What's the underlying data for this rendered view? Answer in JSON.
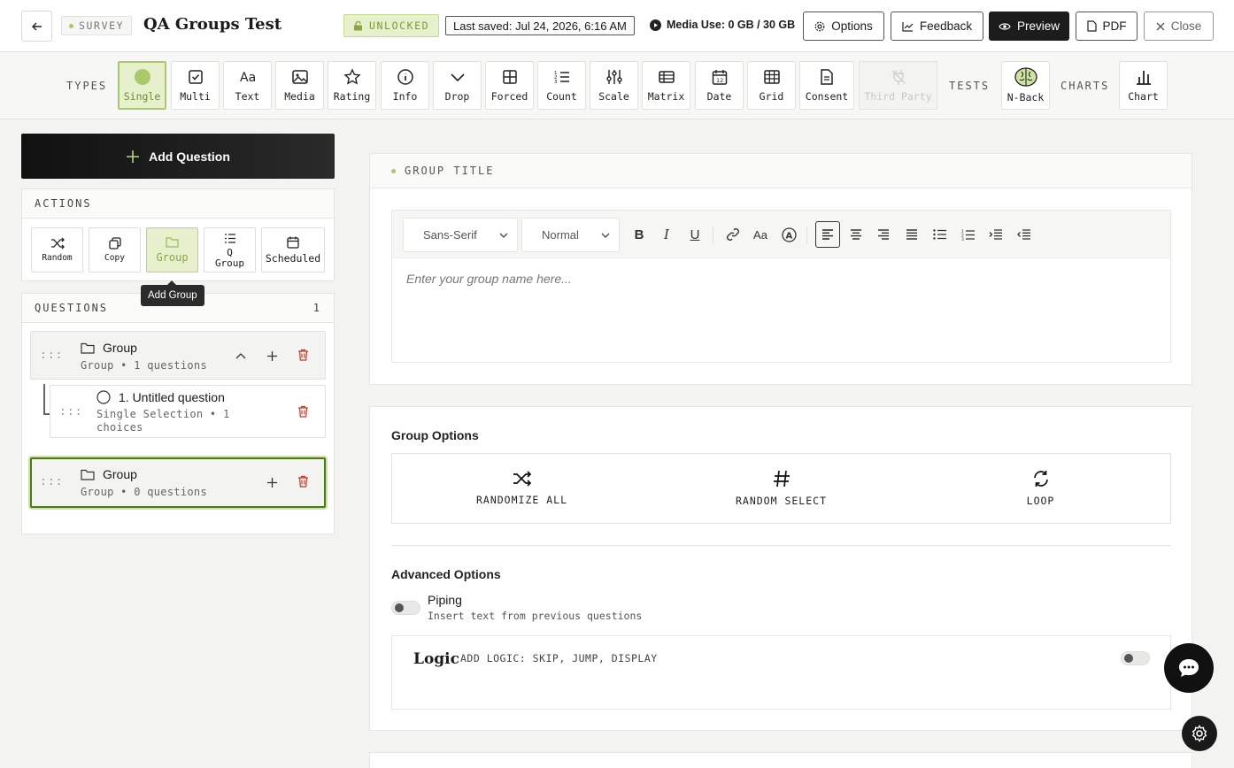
{
  "header": {
    "survey_tag": "SURVEY",
    "title": "QA Groups Test",
    "lock_status": "UNLOCKED",
    "last_saved": "Last saved: Jul 24, 2026, 6:16 AM",
    "media_use": "Media Use: 0 GB / 30 GB",
    "buttons": {
      "options": "Options",
      "feedback": "Feedback",
      "preview": "Preview",
      "pdf": "PDF",
      "close": "Close"
    }
  },
  "toolbar": {
    "types_label": "TYPES",
    "tests_label": "TESTS",
    "charts_label": "CHARTS",
    "types": [
      {
        "label": "Single",
        "icon": "circle-icon",
        "active": true
      },
      {
        "label": "Multi",
        "icon": "checkbox-icon"
      },
      {
        "label": "Text",
        "icon": "text-aa-icon"
      },
      {
        "label": "Media",
        "icon": "image-icon"
      },
      {
        "label": "Rating",
        "icon": "star-icon"
      },
      {
        "label": "Info",
        "icon": "info-icon"
      },
      {
        "label": "Drop",
        "icon": "chevron-down-icon"
      },
      {
        "label": "Forced",
        "icon": "grid-icon"
      },
      {
        "label": "Count",
        "icon": "numbered-list-icon"
      },
      {
        "label": "Scale",
        "icon": "sliders-icon"
      },
      {
        "label": "Matrix",
        "icon": "table-icon"
      },
      {
        "label": "Date",
        "icon": "calendar-icon"
      },
      {
        "label": "Grid",
        "icon": "grid-table-icon"
      },
      {
        "label": "Consent",
        "icon": "document-icon"
      },
      {
        "label": "Third Party",
        "icon": "plug-icon",
        "disabled": true
      }
    ],
    "tests": [
      {
        "label": "N-Back",
        "icon": "brain-icon"
      }
    ],
    "charts": [
      {
        "label": "Chart",
        "icon": "bar-chart-icon"
      }
    ]
  },
  "sidebar": {
    "add_question": "Add Question",
    "actions_label": "ACTIONS",
    "actions": [
      {
        "label": "Random",
        "icon": "shuffle-icon"
      },
      {
        "label": "Copy",
        "icon": "copy-icon"
      },
      {
        "label": "Group",
        "icon": "folder-icon",
        "active": true
      },
      {
        "label": "Q Group",
        "icon": "checklist-icon"
      },
      {
        "label": "Scheduled",
        "icon": "calendar-icon"
      }
    ],
    "tooltip": "Add Group",
    "questions_label": "QUESTIONS",
    "questions_count": "1",
    "groups": [
      {
        "title": "Group",
        "subtitle": "Group • 1 questions"
      },
      {
        "title": "Group",
        "subtitle": "Group • 0 questions"
      }
    ],
    "question": {
      "title": "1. Untitled question",
      "subtitle_line1": "Single Selection • 1",
      "subtitle_line2": "choices"
    }
  },
  "main": {
    "group_title_label": "GROUP TITLE",
    "font_family": "Sans-Serif",
    "font_size": "Normal",
    "placeholder": "Enter your group name here...",
    "group_options_title": "Group Options",
    "group_options": [
      {
        "label": "RANDOMIZE ALL",
        "icon": "shuffle-icon"
      },
      {
        "label": "RANDOM SELECT",
        "icon": "hash-icon"
      },
      {
        "label": "LOOP",
        "icon": "loop-icon"
      }
    ],
    "advanced_title": "Advanced Options",
    "piping_title": "Piping",
    "piping_desc": "Insert text from previous questions",
    "logic_title": "Logic",
    "logic_desc": "ADD LOGIC: SKIP, JUMP, DISPLAY"
  },
  "colors": {
    "accent": "#a9c96a",
    "accent_bg": "#e6f0cc",
    "dark": "#1c1c1c",
    "danger": "#c0392b"
  }
}
